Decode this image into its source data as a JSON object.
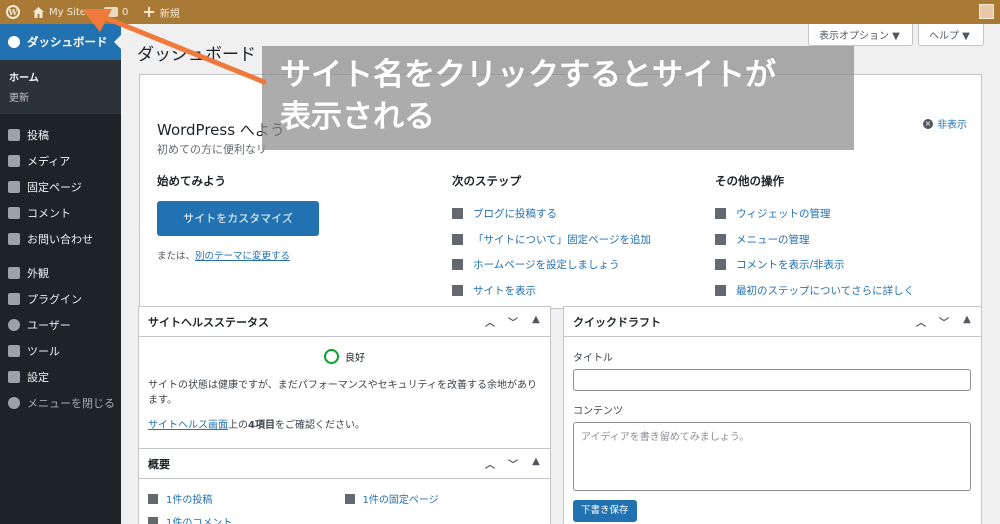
{
  "adminbar": {
    "site_name": "My Site",
    "new_label": "新規",
    "comment_count": "0"
  },
  "sidebar": {
    "dashboard": "ダッシュボード",
    "sub_home": "ホーム",
    "sub_updates": "更新",
    "items": [
      {
        "label": "投稿",
        "icon": "pin-icon"
      },
      {
        "label": "メディア",
        "icon": "media-icon"
      },
      {
        "label": "固定ページ",
        "icon": "page-icon"
      },
      {
        "label": "コメント",
        "icon": "comment-icon"
      },
      {
        "label": "お問い合わせ",
        "icon": "mail-icon"
      }
    ],
    "items2": [
      {
        "label": "外観",
        "icon": "brush-icon"
      },
      {
        "label": "プラグイン",
        "icon": "plugin-icon"
      },
      {
        "label": "ユーザー",
        "icon": "user-icon"
      },
      {
        "label": "ツール",
        "icon": "wrench-icon"
      },
      {
        "label": "設定",
        "icon": "settings-icon"
      }
    ],
    "collapse": "メニューを閉じる"
  },
  "header": {
    "title": "ダッシュボード",
    "screen_options": "表示オプション ▼",
    "help": "ヘルプ ▼"
  },
  "welcome": {
    "title": "WordPress へよう",
    "about": "初めての方に便利なリ",
    "dismiss": "非表示",
    "get_started": "始めてみよう",
    "customize_button": "サイトをカスタマイズ",
    "or_text": "または、",
    "change_theme_link": "別のテーマに変更する",
    "next_steps": "次のステップ",
    "steps": [
      "ブログに投稿する",
      "「サイトについて」固定ページを追加",
      "ホームページを設定しましょう",
      "サイトを表示"
    ],
    "more_actions": "その他の操作",
    "actions": [
      "ウィジェットの管理",
      "メニューの管理",
      "コメントを表示/非表示",
      "最初のステップについてさらに詳しく"
    ]
  },
  "annotation": {
    "line1": "サイト名をクリックするとサイトが",
    "line2": "表示される",
    "arrow_color": "#f07a3c"
  },
  "site_health": {
    "title": "サイトヘルスステータス",
    "status": "良好",
    "description": "サイトの状態は健康ですが、まだパフォーマンスやセキュリティを改善する余地があります。",
    "link_text": "サイトヘルス画面",
    "link_suffix_pre": "上の",
    "items_count": "4項目",
    "link_suffix_post": "をご確認ください。"
  },
  "glance": {
    "title": "概要",
    "posts": "1件の投稿",
    "pages": "1件の固定ページ",
    "comments": "1件のコメント"
  },
  "quick_draft": {
    "title": "クイックドラフト",
    "title_label": "タイトル",
    "content_label": "コンテンツ",
    "content_placeholder": "アイディアを書き留めてみましょう。",
    "save_button": "下書き保存"
  },
  "colors": {
    "admin_bar": "#a87a35",
    "sidebar": "#1d2327",
    "accent": "#2271b1"
  }
}
